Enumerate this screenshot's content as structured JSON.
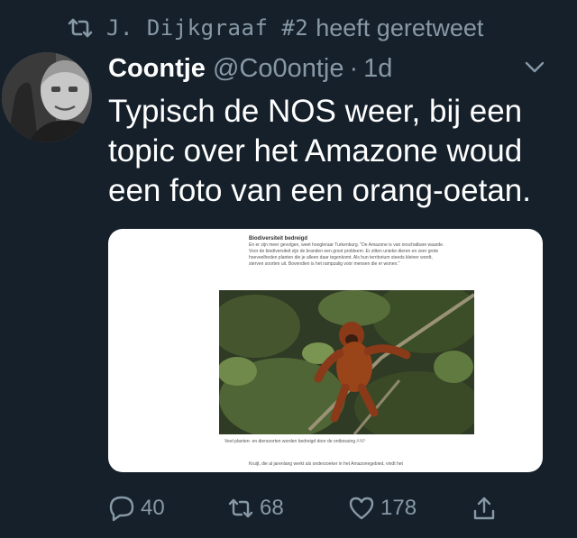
{
  "retweet": {
    "icon": "retweet-icon",
    "name": "J. Dijkgraaf #2",
    "text": "heeft geretweet"
  },
  "tweet": {
    "display_name": "Coontje",
    "handle": "@Co0ontje",
    "separator": "·",
    "time": "1d",
    "text_lines": [
      "Typisch de NOS weer, bij een",
      "topic over het Amazone woud",
      "een foto van een orang-oetan."
    ]
  },
  "media": {
    "heading": "Biodiversiteit bedreigd",
    "paragraph": "En er zijn meer gevolgen, weet hoogleraar Turkenburg. \"De Amazone is van onschatbare waarde. Voor de biodiversiteit zijn de branden een groot probleem. Er zitten unieke dieren en zeer grote hoeveelheden planten die je alleen daar tegenkomt. Als hun territorium steeds kleiner wordt, sterven soorten uit. Bovendien is het rampzalig voor mensen die er wonen.\"",
    "caption": "Veel planten- en diersoorten worden bedreigd door de ontbossing",
    "caption_source": "ANP",
    "paragraph2": "Kruijt, die al jarenlang werkt als onderzoeker in het Amazonegebied, vindt het"
  },
  "actions": {
    "reply_count": "40",
    "retweet_count": "68",
    "like_count": "178"
  },
  "colors": {
    "background": "#15202b",
    "muted": "#8899a6",
    "text": "#ffffff"
  }
}
